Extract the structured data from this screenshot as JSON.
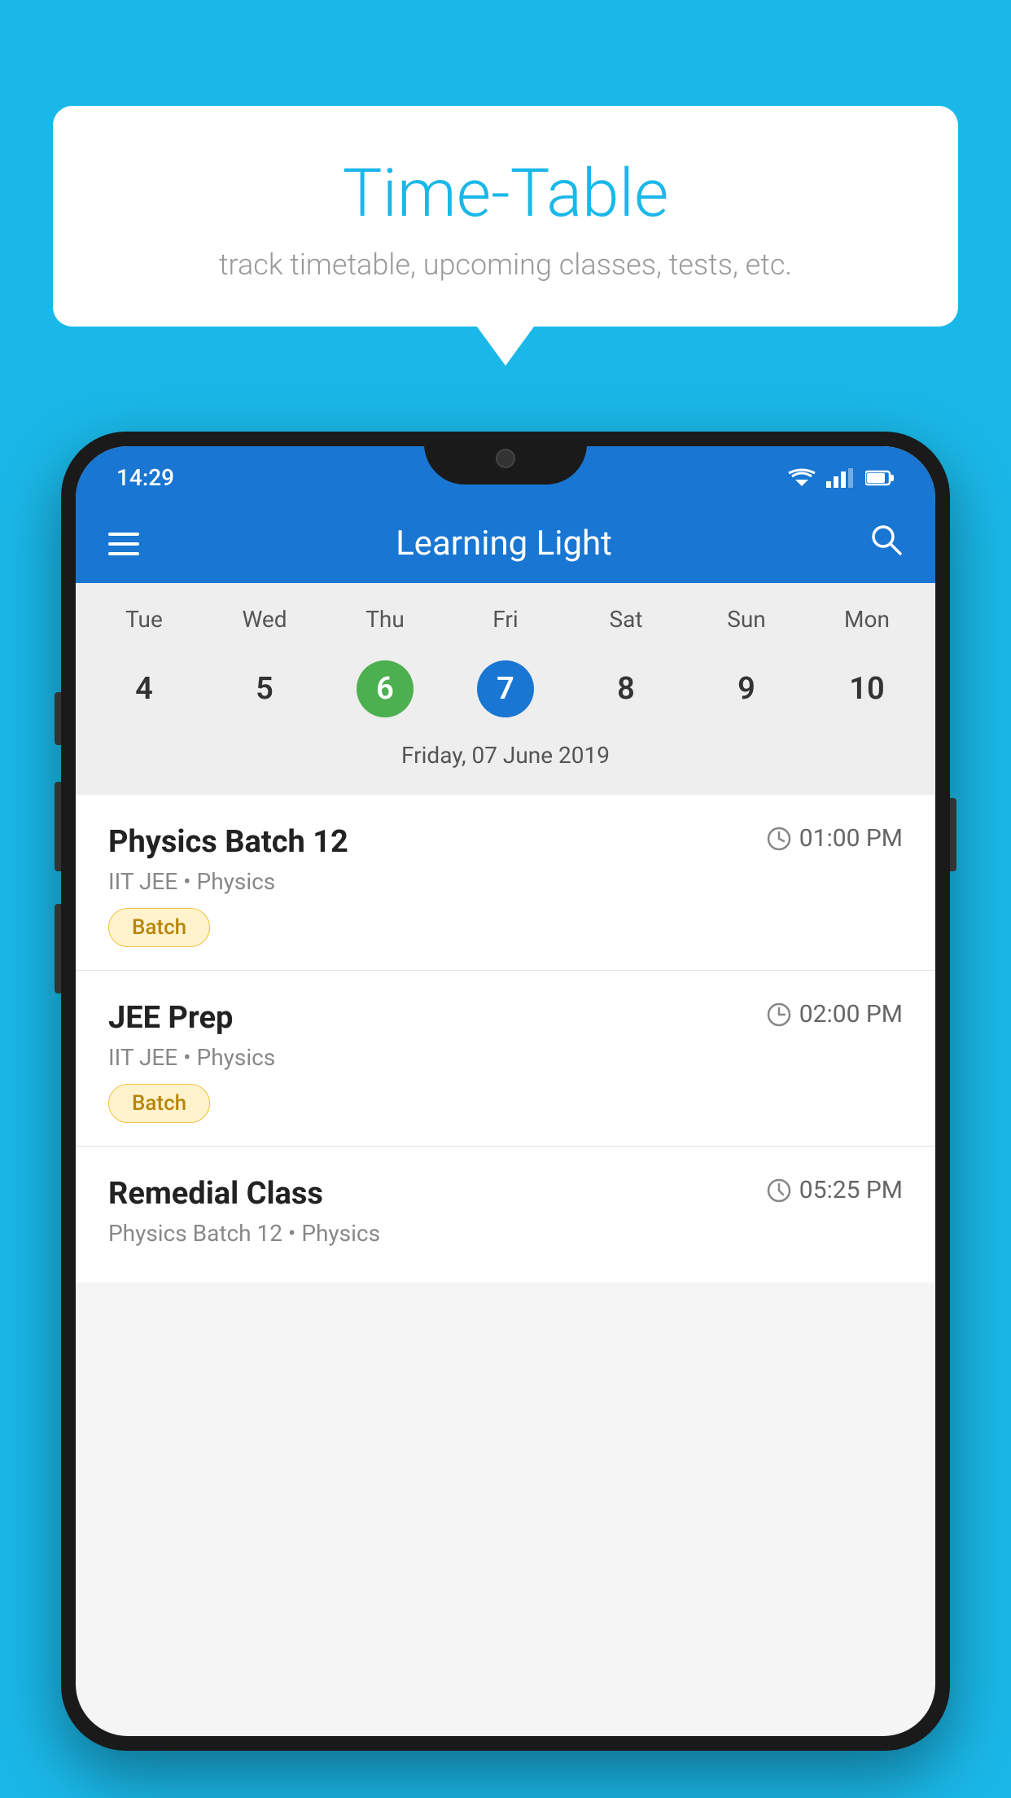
{
  "background": {
    "color": "#1ab8e8"
  },
  "bubble": {
    "title": "Time-Table",
    "subtitle": "track timetable, upcoming classes, tests, etc."
  },
  "phone": {
    "statusBar": {
      "time": "14:29"
    },
    "appBar": {
      "title": "Learning Light"
    },
    "calendar": {
      "days": [
        "Tue",
        "Wed",
        "Thu",
        "Fri",
        "Sat",
        "Sun",
        "Mon"
      ],
      "dates": [
        "4",
        "5",
        "6",
        "7",
        "8",
        "9",
        "10"
      ],
      "todayIndex": 2,
      "selectedIndex": 3,
      "selectedDateLabel": "Friday, 07 June 2019"
    },
    "scheduleItems": [
      {
        "title": "Physics Batch 12",
        "time": "01:00 PM",
        "subtitle": "IIT JEE • Physics",
        "tag": "Batch"
      },
      {
        "title": "JEE Prep",
        "time": "02:00 PM",
        "subtitle": "IIT JEE • Physics",
        "tag": "Batch"
      },
      {
        "title": "Remedial Class",
        "time": "05:25 PM",
        "subtitle": "Physics Batch 12 • Physics",
        "tag": ""
      }
    ]
  }
}
